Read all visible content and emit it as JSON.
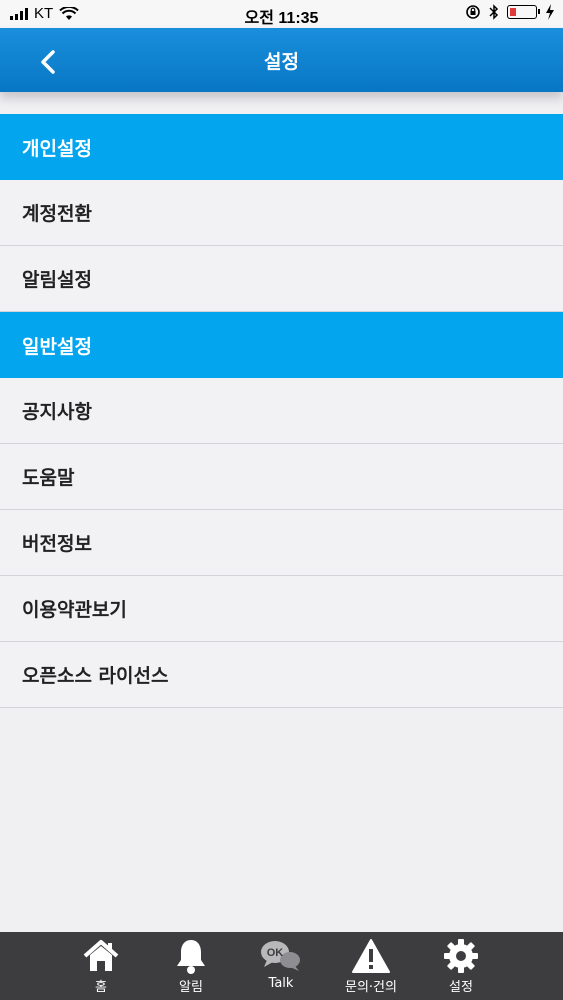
{
  "status_bar": {
    "carrier": "KT",
    "time": "오전 11:35"
  },
  "header": {
    "title": "설정",
    "back_icon": "chevron-left-icon"
  },
  "sections": [
    {
      "title": "개인설정",
      "items": [
        "계정전환",
        "알림설정"
      ]
    },
    {
      "title": "일반설정",
      "items": [
        "공지사항",
        "도움말",
        "버전정보",
        "이용약관보기",
        "오픈소스 라이선스"
      ]
    }
  ],
  "tab_bar": {
    "tabs": [
      {
        "label": "홈",
        "icon": "home-icon"
      },
      {
        "label": "알림",
        "icon": "bell-icon"
      },
      {
        "label": "Talk",
        "icon": "chat-bubble-icon",
        "badge_text": "OK"
      },
      {
        "label": "문의·건의",
        "icon": "warning-icon"
      },
      {
        "label": "설정",
        "icon": "gear-icon"
      }
    ]
  },
  "colors": {
    "header": "#0a7fcf",
    "section": "#04a5ef",
    "tab_bar": "#3d3d3f",
    "background": "#f0f0f3"
  }
}
